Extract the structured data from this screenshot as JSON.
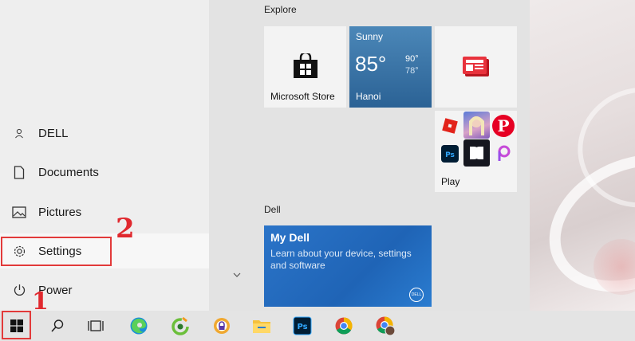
{
  "start_menu": {
    "rail_items": [
      {
        "label": "DELL",
        "icon": "user-icon"
      },
      {
        "label": "Documents",
        "icon": "document-icon"
      },
      {
        "label": "Pictures",
        "icon": "pictures-icon"
      },
      {
        "label": "Settings",
        "icon": "gear-icon"
      },
      {
        "label": "Power",
        "icon": "power-icon"
      }
    ],
    "groups": {
      "explore": "Explore",
      "dell": "Dell"
    },
    "tiles": {
      "store": {
        "label": "Microsoft Store",
        "icon": "store-bag-icon"
      },
      "weather": {
        "condition": "Sunny",
        "temp": "85°",
        "high": "90°",
        "low": "78°",
        "city": "Hanoi"
      },
      "news": {
        "icon": "news-icon",
        "accent": "#e8323c"
      },
      "play": {
        "label": "Play",
        "apps": [
          "roblox-icon",
          "game-icon",
          "pinterest-icon",
          "photoshop-express-icon",
          "dolby-icon",
          "picsart-icon"
        ]
      },
      "mydell": {
        "title": "My Dell",
        "description": "Learn about your device, settings and software",
        "logo": "DELL"
      }
    }
  },
  "annotations": {
    "step1": "1",
    "step2": "2",
    "highlight_color": "#e23a3a"
  },
  "taskbar": {
    "items": [
      "windows-start-icon",
      "search-icon",
      "task-view-icon",
      "edge-icon",
      "coccoc-icon",
      "avast-browser-icon",
      "file-explorer-icon",
      "photoshop-icon",
      "chrome-icon",
      "chrome-profile-icon"
    ]
  }
}
